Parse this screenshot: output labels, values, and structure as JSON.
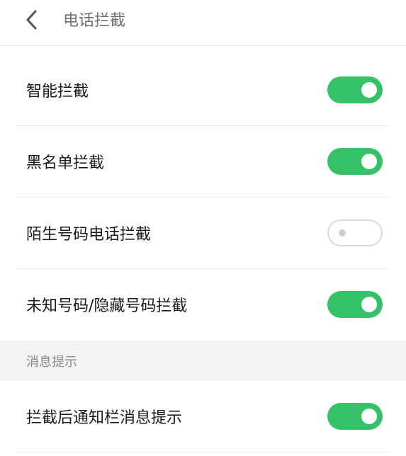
{
  "header": {
    "title": "电话拦截"
  },
  "settings": [
    {
      "label": "智能拦截",
      "enabled": true
    },
    {
      "label": "黑名单拦截",
      "enabled": true
    },
    {
      "label": "陌生号码电话拦截",
      "enabled": false
    },
    {
      "label": "未知号码/隐藏号码拦截",
      "enabled": true
    }
  ],
  "notification_section": {
    "title": "消息提示",
    "items": [
      {
        "label": "拦截后通知栏消息提示",
        "enabled": true
      }
    ]
  },
  "colors": {
    "accent_on": "#35c168",
    "toggle_off_border": "#d9d9d9",
    "section_bg": "#f3f3f3"
  }
}
